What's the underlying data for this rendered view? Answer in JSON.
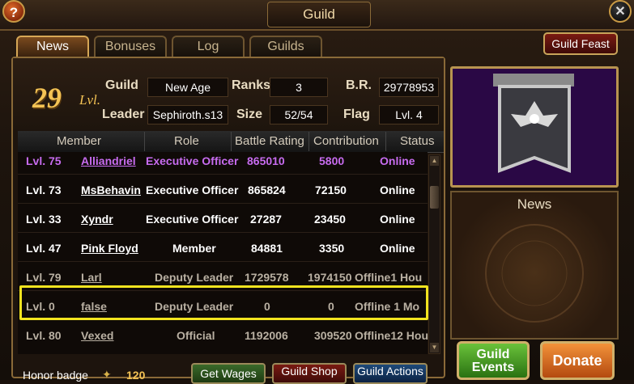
{
  "window": {
    "title": "Guild"
  },
  "header_buttons": {
    "help": "?",
    "close": "✕"
  },
  "tabs": [
    {
      "label": "News",
      "active": true
    },
    {
      "label": "Bonuses",
      "active": false
    },
    {
      "label": "Log",
      "active": false
    },
    {
      "label": "Guilds",
      "active": false
    }
  ],
  "guild_feast": "Guild Feast",
  "guild_info": {
    "level_number": "29",
    "level_suffix": "Lvl.",
    "guild_label": "Guild",
    "guild_value": "New Age",
    "leader_label": "Leader",
    "leader_value": "Sephiroth.s13",
    "ranks_label": "Ranks",
    "ranks_value": "3",
    "size_label": "Size",
    "size_value": "52/54",
    "br_label": "B.R.",
    "br_value": "29778953",
    "flag_label": "Flag",
    "flag_value": "Lvl. 4"
  },
  "table": {
    "headers": [
      "Member",
      "Role",
      "Battle Rating",
      "Contribution",
      "Status"
    ],
    "rows": [
      {
        "level": "Lvl. 75",
        "name": "Alliandriel",
        "role": "Executive Officer",
        "battle_rating": "865010",
        "contribution": "5800",
        "status": "Online",
        "style": "purple"
      },
      {
        "level": "Lvl. 73",
        "name": "MsBehavin",
        "role": "Executive Officer",
        "battle_rating": "865824",
        "contribution": "72150",
        "status": "Online",
        "style": "normal"
      },
      {
        "level": "Lvl. 33",
        "name": "Xyndr",
        "role": "Executive Officer",
        "battle_rating": "27287",
        "contribution": "23450",
        "status": "Online",
        "style": "normal"
      },
      {
        "level": "Lvl. 47",
        "name": "Pink Floyd",
        "role": "Member",
        "battle_rating": "84881",
        "contribution": "3350",
        "status": "Online",
        "style": "normal"
      },
      {
        "level": "Lvl. 79",
        "name": "Larl",
        "role": "Deputy Leader",
        "battle_rating": "1729578",
        "contribution": "1974150",
        "status": "Offline1 Hou",
        "style": "dim"
      },
      {
        "level": "Lvl. 0",
        "name": "false",
        "role": "Deputy Leader",
        "battle_rating": "0",
        "contribution": "0",
        "status": "Offline 1 Mo",
        "style": "dim"
      },
      {
        "level": "Lvl. 80",
        "name": "Vexed",
        "role": "Official",
        "battle_rating": "1192006",
        "contribution": "309520",
        "status": "Offline12 Hou",
        "style": "dim"
      }
    ]
  },
  "bottom": {
    "honor_label": "Honor badge",
    "honor_value": "120",
    "get_wages": "Get Wages",
    "guild_shop": "Guild Shop",
    "guild_actions": "Guild Actions"
  },
  "right": {
    "news_title": "News",
    "guild_events": "Guild Events",
    "donate": "Donate"
  },
  "colors": {
    "highlight": "#f2e41f",
    "officer_purple": "#c86cf0",
    "gold": "#f4c354"
  }
}
